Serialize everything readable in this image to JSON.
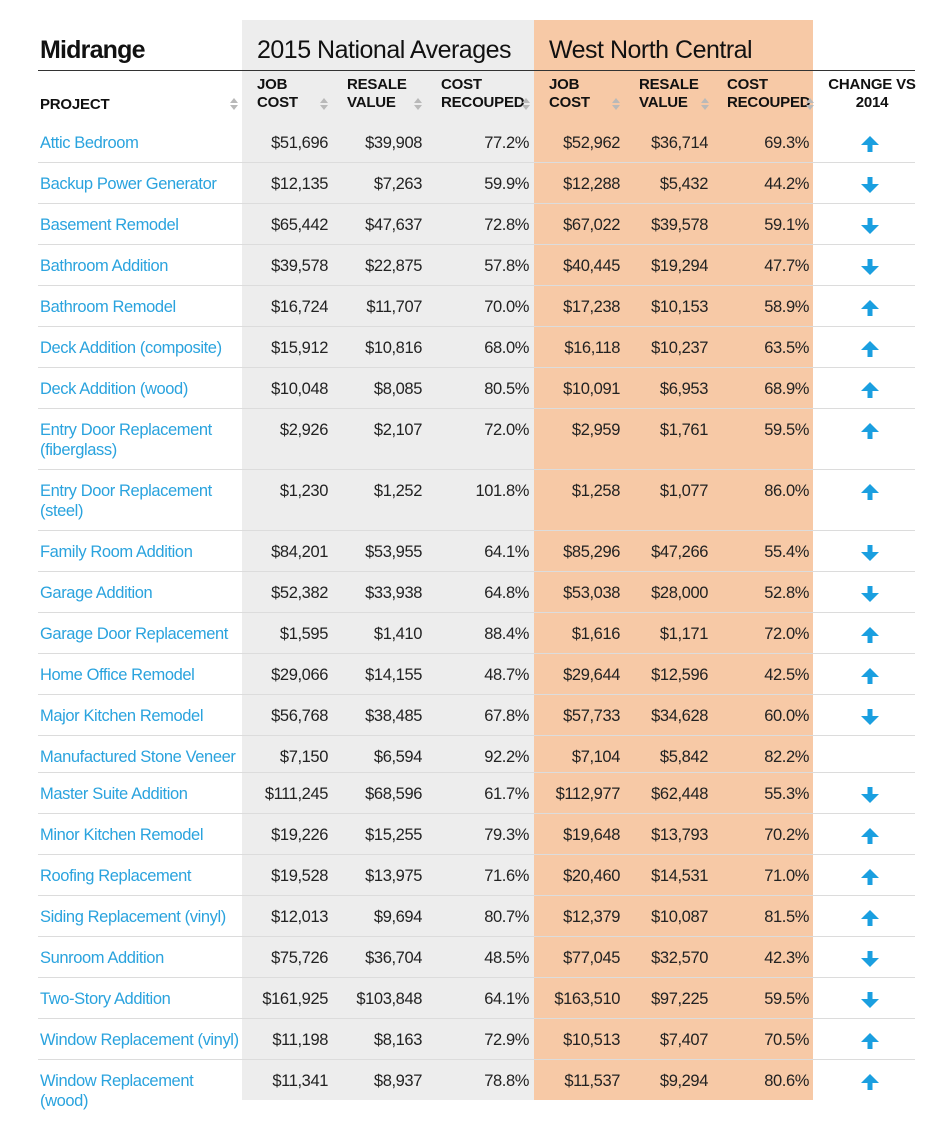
{
  "title": {
    "left": "Midrange",
    "national": "2015 National Averages",
    "region": "West North Central"
  },
  "headers": {
    "project": "PROJECT",
    "job_cost": [
      "JOB",
      "COST"
    ],
    "resale_value": [
      "RESALE",
      "VALUE"
    ],
    "cost_recouped": [
      "COST",
      "RECOUPED"
    ],
    "change": [
      "CHANGE VS",
      "2014"
    ]
  },
  "colors": {
    "national_bg": "#ededed",
    "region_bg": "#f7c9a6",
    "project_link": "#2aa3de",
    "arrow": "#1a9fe0"
  },
  "rows": [
    {
      "project": "Attic Bedroom",
      "nat_job": "$51,696",
      "nat_resale": "$39,908",
      "nat_recouped": "77.2%",
      "reg_job": "$52,962",
      "reg_resale": "$36,714",
      "reg_recouped": "69.3%",
      "change": "up"
    },
    {
      "project": "Backup Power Generator",
      "nat_job": "$12,135",
      "nat_resale": "$7,263",
      "nat_recouped": "59.9%",
      "reg_job": "$12,288",
      "reg_resale": "$5,432",
      "reg_recouped": "44.2%",
      "change": "down"
    },
    {
      "project": "Basement Remodel",
      "nat_job": "$65,442",
      "nat_resale": "$47,637",
      "nat_recouped": "72.8%",
      "reg_job": "$67,022",
      "reg_resale": "$39,578",
      "reg_recouped": "59.1%",
      "change": "down"
    },
    {
      "project": "Bathroom Addition",
      "nat_job": "$39,578",
      "nat_resale": "$22,875",
      "nat_recouped": "57.8%",
      "reg_job": "$40,445",
      "reg_resale": "$19,294",
      "reg_recouped": "47.7%",
      "change": "down"
    },
    {
      "project": "Bathroom Remodel",
      "nat_job": "$16,724",
      "nat_resale": "$11,707",
      "nat_recouped": "70.0%",
      "reg_job": "$17,238",
      "reg_resale": "$10,153",
      "reg_recouped": "58.9%",
      "change": "up"
    },
    {
      "project": "Deck Addition (composite)",
      "nat_job": "$15,912",
      "nat_resale": "$10,816",
      "nat_recouped": "68.0%",
      "reg_job": "$16,118",
      "reg_resale": "$10,237",
      "reg_recouped": "63.5%",
      "change": "up"
    },
    {
      "project": "Deck Addition (wood)",
      "nat_job": "$10,048",
      "nat_resale": "$8,085",
      "nat_recouped": "80.5%",
      "reg_job": "$10,091",
      "reg_resale": "$6,953",
      "reg_recouped": "68.9%",
      "change": "up"
    },
    {
      "project": "Entry Door Replacement (fiberglass)",
      "nat_job": "$2,926",
      "nat_resale": "$2,107",
      "nat_recouped": "72.0%",
      "reg_job": "$2,959",
      "reg_resale": "$1,761",
      "reg_recouped": "59.5%",
      "change": "up",
      "tall": true
    },
    {
      "project": "Entry Door Replacement (steel)",
      "nat_job": "$1,230",
      "nat_resale": "$1,252",
      "nat_recouped": "101.8%",
      "reg_job": "$1,258",
      "reg_resale": "$1,077",
      "reg_recouped": "86.0%",
      "change": "up",
      "tall": true
    },
    {
      "project": "Family Room Addition",
      "nat_job": "$84,201",
      "nat_resale": "$53,955",
      "nat_recouped": "64.1%",
      "reg_job": "$85,296",
      "reg_resale": "$47,266",
      "reg_recouped": "55.4%",
      "change": "down"
    },
    {
      "project": "Garage Addition",
      "nat_job": "$52,382",
      "nat_resale": "$33,938",
      "nat_recouped": "64.8%",
      "reg_job": "$53,038",
      "reg_resale": "$28,000",
      "reg_recouped": "52.8%",
      "change": "down"
    },
    {
      "project": "Garage Door Replacement",
      "nat_job": "$1,595",
      "nat_resale": "$1,410",
      "nat_recouped": "88.4%",
      "reg_job": "$1,616",
      "reg_resale": "$1,171",
      "reg_recouped": "72.0%",
      "change": "up"
    },
    {
      "project": "Home Office Remodel",
      "nat_job": "$29,066",
      "nat_resale": "$14,155",
      "nat_recouped": "48.7%",
      "reg_job": "$29,644",
      "reg_resale": "$12,596",
      "reg_recouped": "42.5%",
      "change": "up"
    },
    {
      "project": "Major Kitchen Remodel",
      "nat_job": "$56,768",
      "nat_resale": "$38,485",
      "nat_recouped": "67.8%",
      "reg_job": "$57,733",
      "reg_resale": "$34,628",
      "reg_recouped": "60.0%",
      "change": "down"
    },
    {
      "project": "Manufactured Stone Veneer",
      "nat_job": "$7,150",
      "nat_resale": "$6,594",
      "nat_recouped": "92.2%",
      "reg_job": "$7,104",
      "reg_resale": "$5,842",
      "reg_recouped": "82.2%",
      "change": "none",
      "short": true
    },
    {
      "project": "Master Suite Addition",
      "nat_job": "$111,245",
      "nat_resale": "$68,596",
      "nat_recouped": "61.7%",
      "reg_job": "$112,977",
      "reg_resale": "$62,448",
      "reg_recouped": "55.3%",
      "change": "down"
    },
    {
      "project": "Minor Kitchen Remodel",
      "nat_job": "$19,226",
      "nat_resale": "$15,255",
      "nat_recouped": "79.3%",
      "reg_job": "$19,648",
      "reg_resale": "$13,793",
      "reg_recouped": "70.2%",
      "change": "up"
    },
    {
      "project": "Roofing Replacement",
      "nat_job": "$19,528",
      "nat_resale": "$13,975",
      "nat_recouped": "71.6%",
      "reg_job": "$20,460",
      "reg_resale": "$14,531",
      "reg_recouped": "71.0%",
      "change": "up"
    },
    {
      "project": "Siding Replacement (vinyl)",
      "nat_job": "$12,013",
      "nat_resale": "$9,694",
      "nat_recouped": "80.7%",
      "reg_job": "$12,379",
      "reg_resale": "$10,087",
      "reg_recouped": "81.5%",
      "change": "up"
    },
    {
      "project": "Sunroom Addition",
      "nat_job": "$75,726",
      "nat_resale": "$36,704",
      "nat_recouped": "48.5%",
      "reg_job": "$77,045",
      "reg_resale": "$32,570",
      "reg_recouped": "42.3%",
      "change": "down"
    },
    {
      "project": "Two-Story Addition",
      "nat_job": "$161,925",
      "nat_resale": "$103,848",
      "nat_recouped": "64.1%",
      "reg_job": "$163,510",
      "reg_resale": "$97,225",
      "reg_recouped": "59.5%",
      "change": "down"
    },
    {
      "project": "Window Replacement (vinyl)",
      "nat_job": "$11,198",
      "nat_resale": "$8,163",
      "nat_recouped": "72.9%",
      "reg_job": "$10,513",
      "reg_resale": "$7,407",
      "reg_recouped": "70.5%",
      "change": "up"
    },
    {
      "project": "Window Replacement (wood)",
      "nat_job": "$11,341",
      "nat_resale": "$8,937",
      "nat_recouped": "78.8%",
      "reg_job": "$11,537",
      "reg_resale": "$9,294",
      "reg_recouped": "80.6%",
      "change": "up"
    }
  ]
}
